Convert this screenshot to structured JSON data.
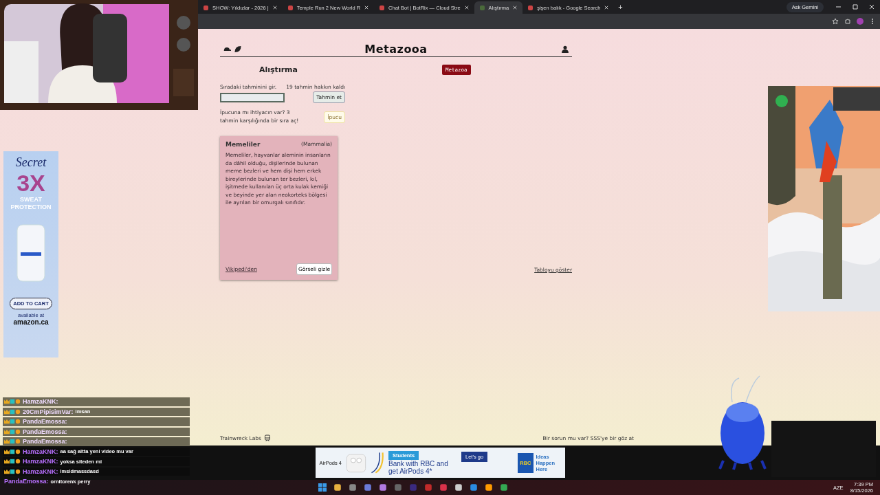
{
  "browser": {
    "tabs": [
      {
        "title": "SHOW: Yıldızlar - 2026 |",
        "selected": false
      },
      {
        "title": "Temple Run 2 New World R",
        "selected": false
      },
      {
        "title": "Chat Bot | BotRix — Cloud Stre",
        "selected": false
      },
      {
        "title": "Alıştırma",
        "selected": true
      },
      {
        "title": "şişen balık - Google Search",
        "selected": false
      }
    ],
    "new_tab": "+",
    "ask_gemini": "Ask Gemini"
  },
  "side_ad": {
    "brand": "Secret",
    "headline": "3X",
    "subhead": "SWEAT PROTECTION",
    "button": "ADD TO CART",
    "available": "available at",
    "store": "amazon.ca"
  },
  "page": {
    "logo": "Metazooa",
    "mode": "Alıştırma",
    "badge": "Metazoa",
    "guess_label": "Sıradaki tahminini gir.",
    "guesses_left": "19 tahmin hakkın kaldı",
    "guess_button": "Tahmin et",
    "hint_text": "İpucuna mı ihtiyacın var? 3 tahmin karşılığında bir sıra aç!",
    "hint_button": "İpucu",
    "card": {
      "name": "Memeliler",
      "latin": "(Mammalia)",
      "description": "Memeliler, hayvanlar aleminin insanların da dâhil olduğu, dişilerinde bulunan meme bezleri ve hem dişi hem erkek bireylerinde bulunan ter bezleri, kıl, işitmede kullanılan üç orta kulak kemiği ve beyinde yer alan neokorteks bölgesi ile ayrılan bir omurgalı sınıfıdır.",
      "source": "Vikipedi'den",
      "hide_button": "Görseli gizle"
    },
    "table_link": "Tabloyu göster",
    "footer_brand": "Trainwreck Labs",
    "footer_help": "Bir sorun mu var? SSS'ye bir göz at"
  },
  "chat": [
    {
      "kind": "faded",
      "name": "HamzaKNK:"
    },
    {
      "kind": "faded",
      "name": "20CmPipisimVar:",
      "text": "imsan"
    },
    {
      "kind": "faded",
      "name": "PandaEmossa:"
    },
    {
      "kind": "faded",
      "name": "PandaEmossa:"
    },
    {
      "kind": "faded",
      "name": "PandaEmossa:"
    },
    {
      "kind": "recent",
      "name": "HamzaKNK:",
      "color": "#b870ff",
      "text": "aa sağ altta yeni video mu var"
    },
    {
      "kind": "recent",
      "name": "HamzaKNK:",
      "color": "#b870ff",
      "text": "yoksa siteden mi"
    },
    {
      "kind": "recent",
      "name": "HamzaKNK:",
      "color": "#b870ff",
      "text": "lmsldmassdasd"
    },
    {
      "kind": "plain",
      "name": "PandaEmossa:",
      "color": "#b870ff",
      "text": "ornitorenk perry"
    }
  ],
  "bottom_ad": {
    "product": "AirPods 4",
    "tag": "Students",
    "headline": "Bank with RBC and get AirPods 4*",
    "button": "Let's go",
    "bank": "RBC",
    "slogan": "Ideas Happen Here"
  },
  "taskbar": {
    "language": "AZE",
    "time": "7:39 PM",
    "date": "8/15/2026"
  }
}
